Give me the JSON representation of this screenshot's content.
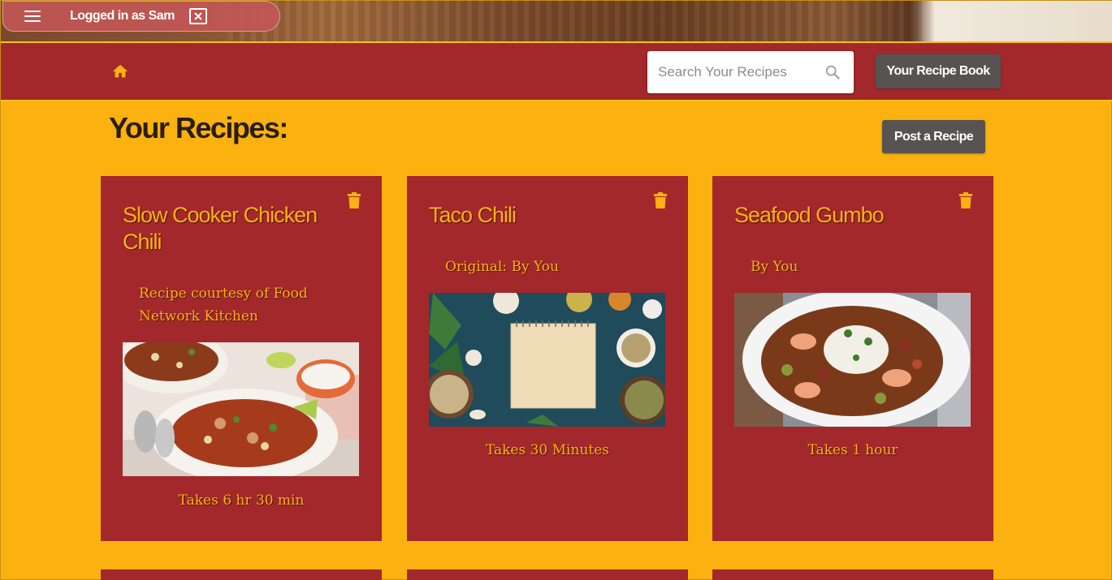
{
  "session": {
    "logged_in_label": "Logged in as Sam"
  },
  "nav": {
    "search_placeholder": "Search Your Recipes",
    "recipe_book_label": "Your Recipe Book"
  },
  "page": {
    "title": "Your Recipes:",
    "post_button_label": "Post a Recipe"
  },
  "recipes": [
    {
      "title": "Slow Cooker Chicken Chili",
      "source": "Recipe courtesy of Food Network Kitchen",
      "time": "Takes 6 hr 30 min",
      "image": "chili-bowl-photo"
    },
    {
      "title": "Taco Chili",
      "source": "Original: By You",
      "time": "Takes 30 Minutes",
      "image": "notebook-spices-photo"
    },
    {
      "title": "Seafood Gumbo",
      "source": "By You",
      "time": "Takes 1 hour",
      "image": "gumbo-bowl-photo"
    }
  ],
  "colors": {
    "background": "#fbb10f",
    "nav_red": "#a3282b",
    "button_gray": "#575352",
    "accent_yellow": "#fbb10f"
  }
}
